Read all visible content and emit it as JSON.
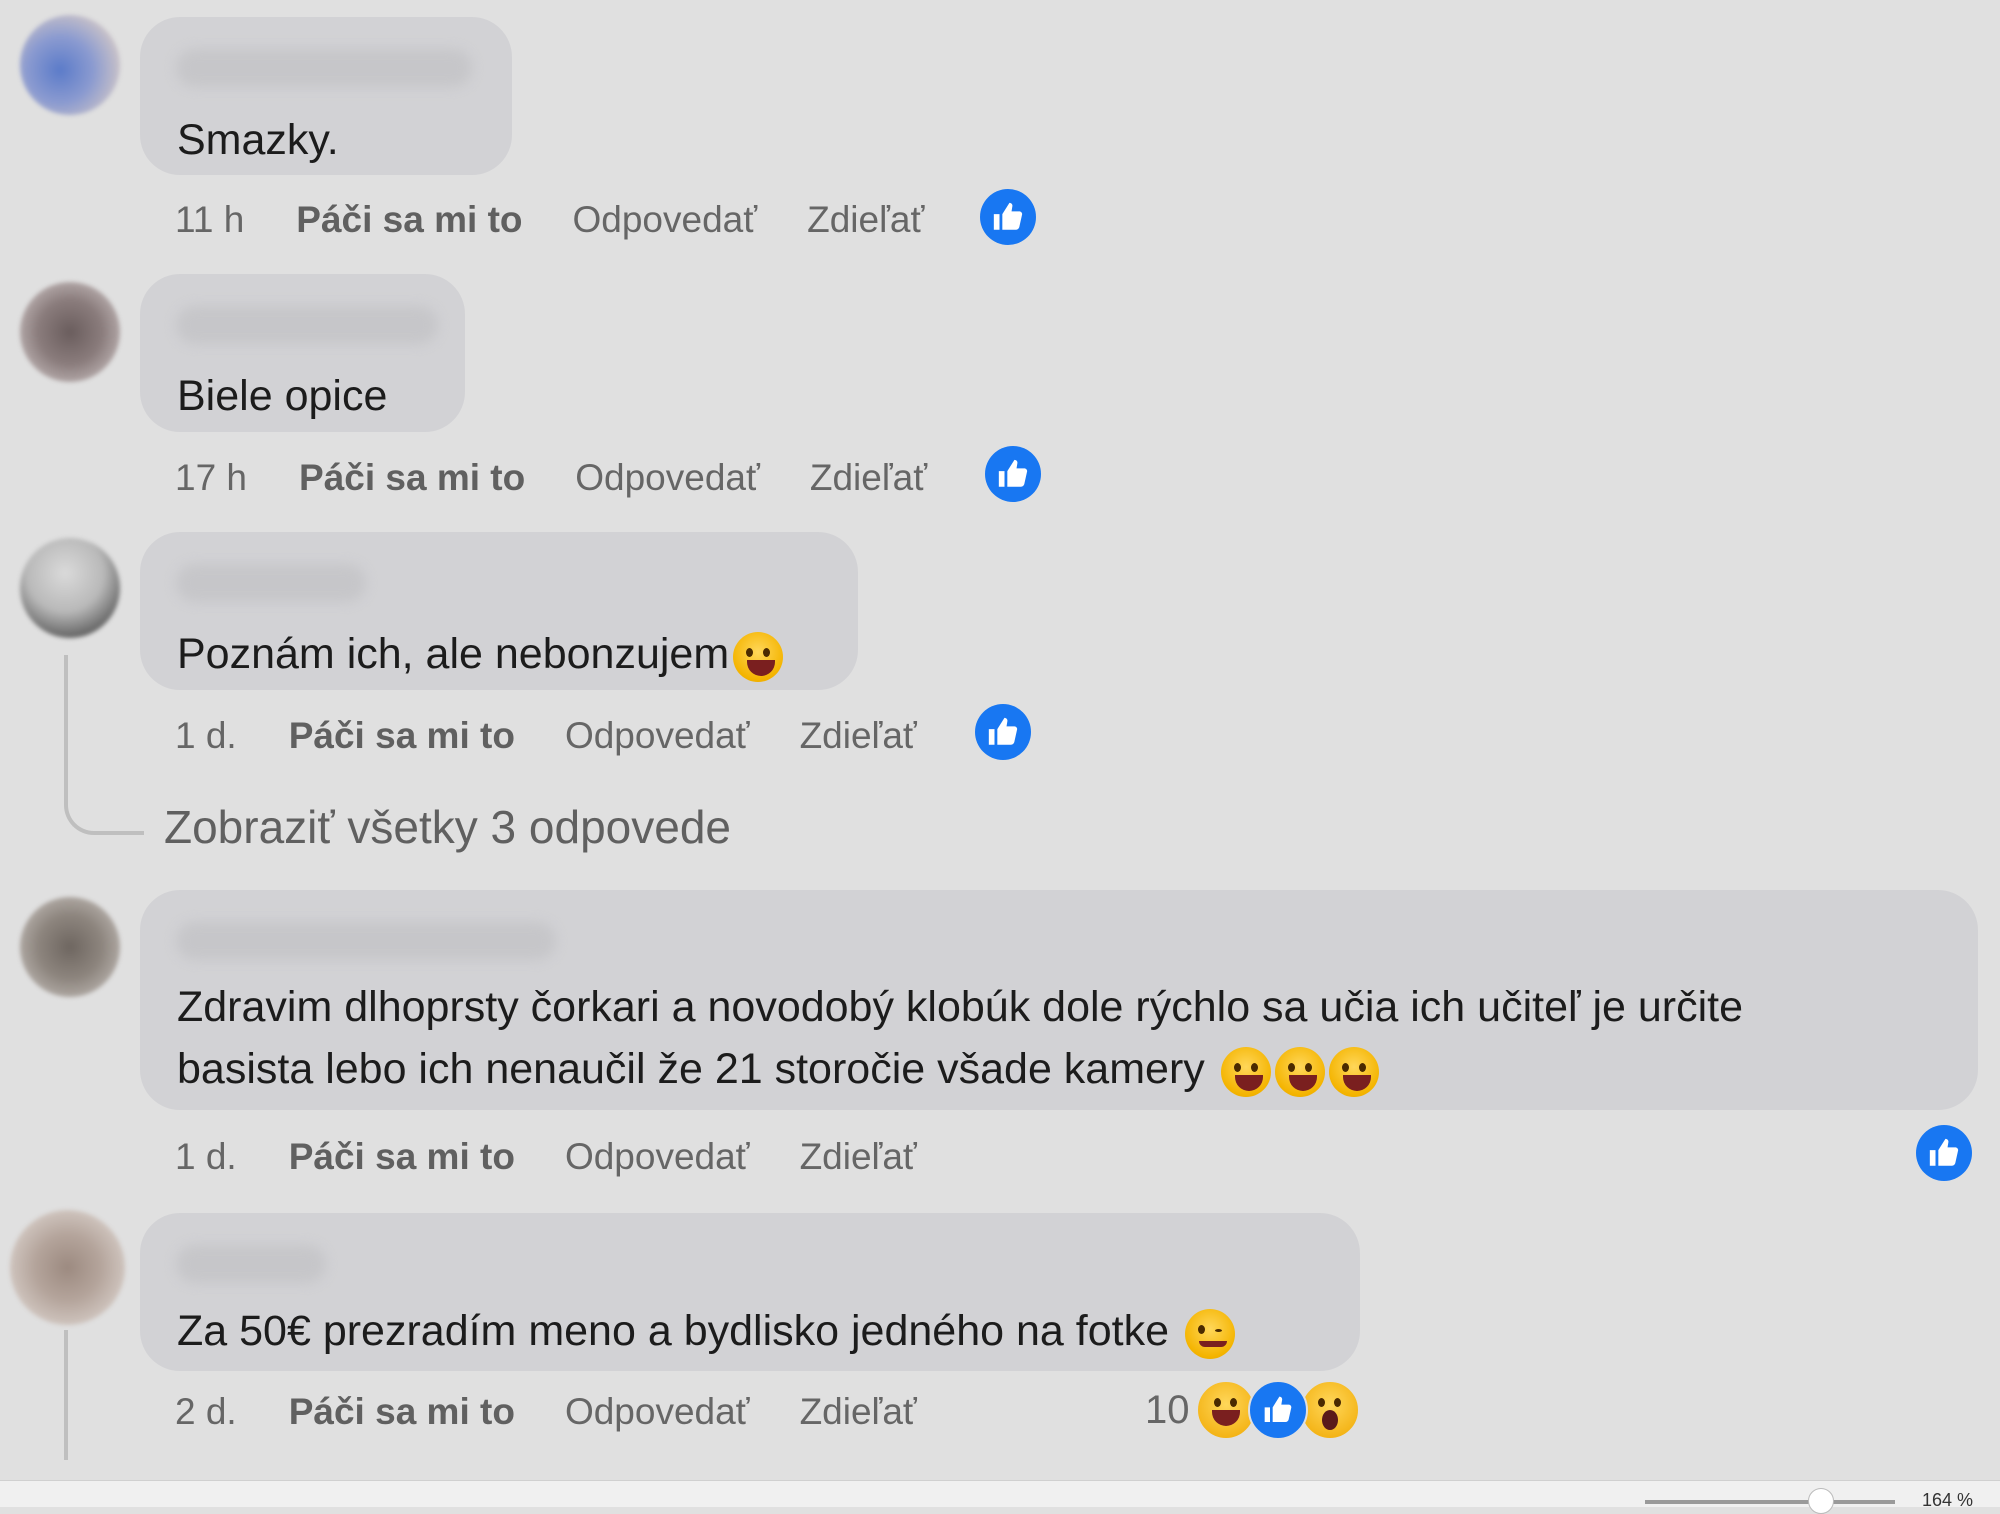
{
  "comments": [
    {
      "text": "Smazky.",
      "time": "11 h",
      "like_label": "Páči sa mi to",
      "reply_label": "Odpovedať",
      "share_label": "Zdieľať"
    },
    {
      "text": "Biele opice",
      "time": "17 h",
      "like_label": "Páči sa mi to",
      "reply_label": "Odpovedať",
      "share_label": "Zdieľať"
    },
    {
      "text": "Poznám ich, ale nebonzujem",
      "time": "1 d.",
      "like_label": "Páči sa mi to",
      "reply_label": "Odpovedať",
      "share_label": "Zdieľať"
    },
    {
      "text_line1": "Zdravim dlhoprsty čorkari a novodobý klobúk dole rýchlo sa učia ich učiteľ je určite",
      "text_line2": "basista lebo ich nenaučil že 21 storočie všade kamery",
      "time": "1 d.",
      "like_label": "Páči sa mi to",
      "reply_label": "Odpovedať",
      "share_label": "Zdieľať"
    },
    {
      "text": "Za 50€ prezradím meno a bydlisko jedného na fotke",
      "time": "2 d.",
      "like_label": "Páči sa mi to",
      "reply_label": "Odpovedať",
      "share_label": "Zdieľať",
      "reaction_count": "10"
    }
  ],
  "view_replies_label": "Zobraziť všetky 3 odpovede",
  "zoom_label": "164 %",
  "colors": {
    "background": "#e0e0e0",
    "bubble": "#d2d2d5",
    "like_blue": "#1877f2",
    "muted_text": "#666666"
  }
}
